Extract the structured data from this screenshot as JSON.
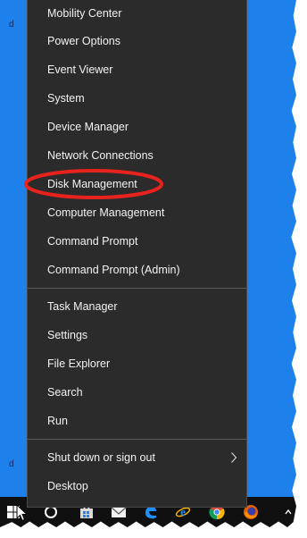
{
  "desktop": {
    "peek_left_top": "d",
    "peek_left_bottom": "d"
  },
  "menu": {
    "groups": [
      {
        "items": [
          {
            "label": "Mobility Center"
          },
          {
            "label": "Power Options"
          },
          {
            "label": "Event Viewer"
          },
          {
            "label": "System"
          },
          {
            "label": "Device Manager"
          },
          {
            "label": "Network Connections"
          },
          {
            "label": "Disk Management"
          },
          {
            "label": "Computer Management"
          },
          {
            "label": "Command Prompt"
          },
          {
            "label": "Command Prompt (Admin)"
          }
        ]
      },
      {
        "items": [
          {
            "label": "Task Manager"
          },
          {
            "label": "Settings"
          },
          {
            "label": "File Explorer"
          },
          {
            "label": "Search"
          },
          {
            "label": "Run"
          }
        ]
      },
      {
        "items": [
          {
            "label": "Shut down or sign out",
            "has_submenu": true,
            "submenu_icon": "chevron-right-icon"
          },
          {
            "label": "Desktop"
          }
        ]
      }
    ],
    "highlighted_item": "Disk Management",
    "highlight_color": "#e8221c"
  },
  "taskbar": {
    "icons": [
      "windows-start-icon",
      "cortana-icon",
      "store-icon",
      "mail-icon",
      "edge-icon",
      "internet-explorer-icon",
      "chrome-icon",
      "firefox-icon"
    ]
  },
  "colors": {
    "menu_bg": "#2b2b2b",
    "menu_text": "#f2f2f2",
    "desktop_bg": "#1e80ea",
    "taskbar_bg": "#101010"
  }
}
